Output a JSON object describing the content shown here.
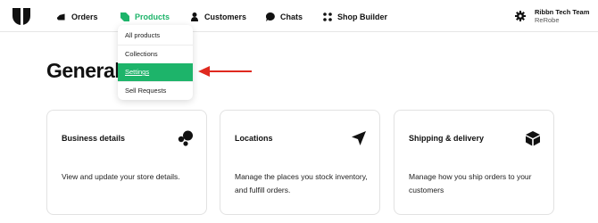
{
  "nav": {
    "items": [
      {
        "label": "Orders",
        "icon": "tag-icon"
      },
      {
        "label": "Products",
        "icon": "leaf-icon",
        "active": true
      },
      {
        "label": "Customers",
        "icon": "person-icon"
      },
      {
        "label": "Chats",
        "icon": "chat-bubble-icon"
      },
      {
        "label": "Shop Builder",
        "icon": "dots-grid-icon"
      }
    ],
    "active_color": "#1db46a"
  },
  "account": {
    "team": "Ribbn Tech Team",
    "store": "ReRobe",
    "icon": "gear-icon"
  },
  "page": {
    "title": "General"
  },
  "products_menu": {
    "options": [
      "All products",
      "Collections",
      "Settings",
      "Sell Requests"
    ],
    "selected": "Settings"
  },
  "annotation": {
    "arrow_color": "#e0291f"
  },
  "cards": [
    {
      "title": "Business details",
      "description": "View and update your store details.",
      "icon": "bubbles-icon"
    },
    {
      "title": "Locations",
      "description": "Manage the places you stock inventory, and fulfill orders.",
      "icon": "navigation-arrow-icon"
    },
    {
      "title": "Shipping & delivery",
      "description": "Manage how you ship orders to your customers",
      "icon": "package-box-icon"
    }
  ]
}
